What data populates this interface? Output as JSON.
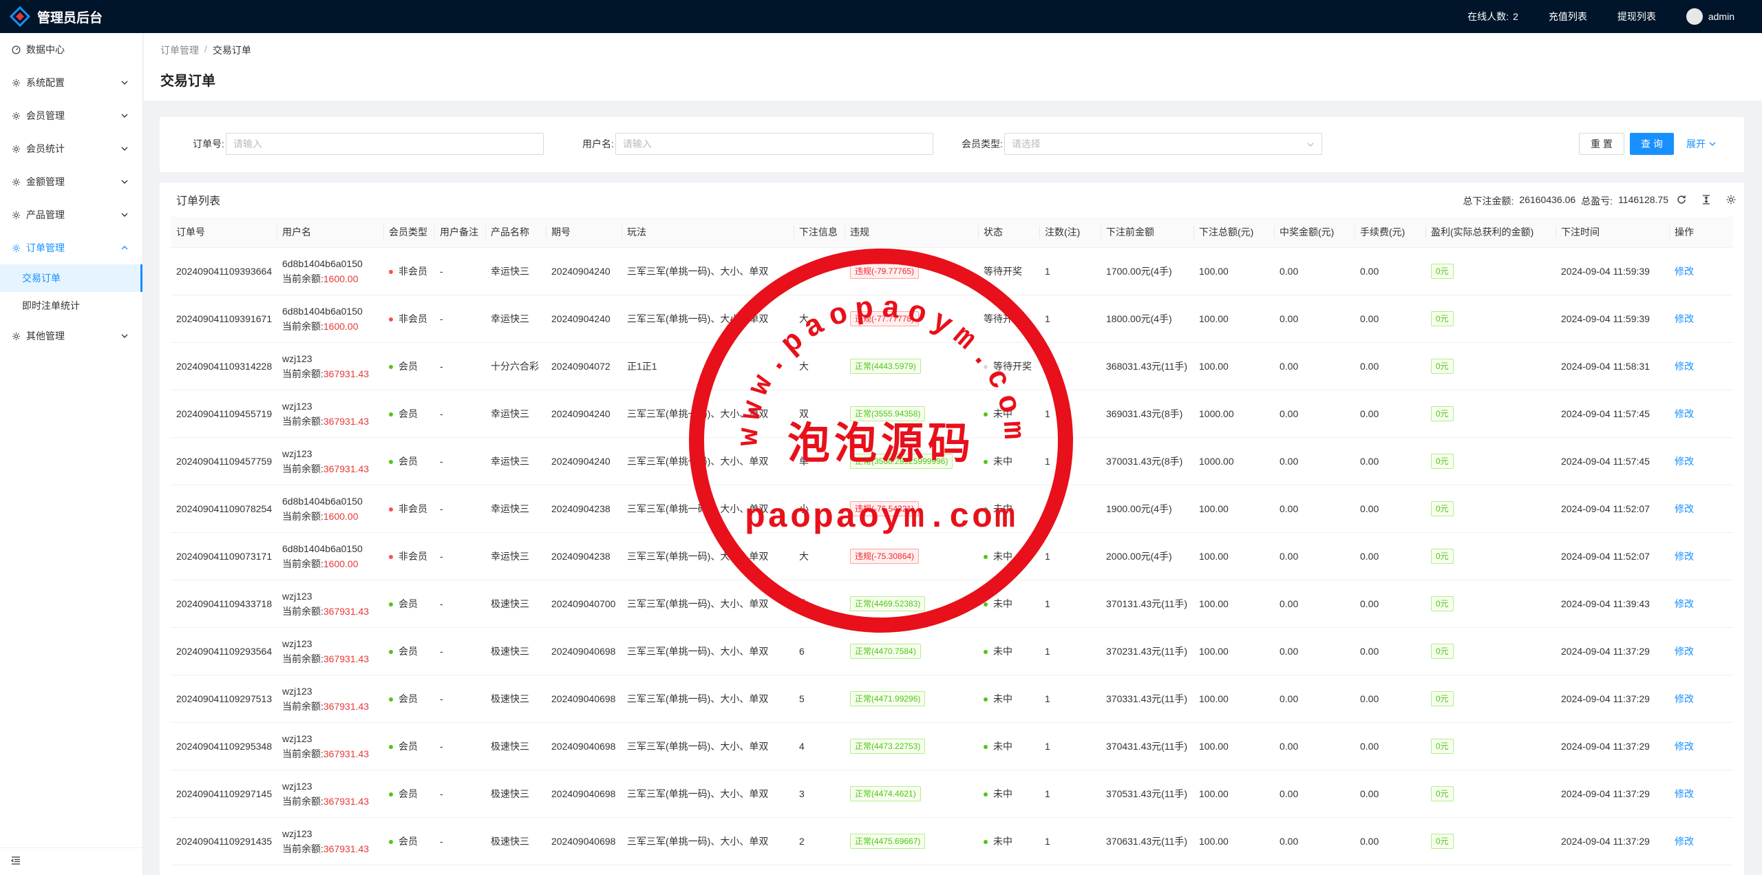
{
  "header": {
    "title": "管理员后台",
    "online_label": "在线人数:",
    "online_count": "2",
    "recharge_list": "充值列表",
    "withdraw_list": "提现列表",
    "user": "admin"
  },
  "sidebar": {
    "items": [
      {
        "label": "数据中心",
        "icon": "dashboard-icon",
        "has_children": false
      },
      {
        "label": "系统配置",
        "icon": "gear-icon",
        "has_children": true
      },
      {
        "label": "会员管理",
        "icon": "gear-icon",
        "has_children": true
      },
      {
        "label": "会员统计",
        "icon": "gear-icon",
        "has_children": true
      },
      {
        "label": "金额管理",
        "icon": "gear-icon",
        "has_children": true
      },
      {
        "label": "产品管理",
        "icon": "gear-icon",
        "has_children": true
      },
      {
        "label": "订单管理",
        "icon": "gear-icon",
        "has_children": true,
        "open": true
      },
      {
        "label": "其他管理",
        "icon": "gear-icon",
        "has_children": true
      }
    ],
    "sub_items": [
      "交易订单",
      "即时注单统计"
    ]
  },
  "breadcrumb": {
    "parent": "订单管理",
    "sep": "/",
    "current": "交易订单"
  },
  "page_title": "交易订单",
  "search": {
    "order_no_label": "订单号:",
    "order_no_placeholder": "请输入",
    "username_label": "用户名:",
    "username_placeholder": "请输入",
    "member_type_label": "会员类型:",
    "member_type_placeholder": "请选择",
    "reset": "重 置",
    "query": "查 询",
    "expand": "展开"
  },
  "table": {
    "title": "订单列表",
    "total_bet_label": "总下注金额:",
    "total_bet": "26160436.06",
    "total_profit_label": "总盈亏:",
    "total_profit": "1146128.75",
    "columns": [
      "订单号",
      "用户名",
      "会员类型",
      "用户备注",
      "产品名称",
      "期号",
      "玩法",
      "下注信息",
      "违规",
      "状态",
      "注数(注)",
      "下注前金额",
      "下注总额(元)",
      "中奖金额(元)",
      "手续费(元)",
      "盈利(实际总获利的金额)",
      "下注时间",
      "操作"
    ],
    "balance_label": "当前余额:",
    "edit_label": "修改",
    "rows": [
      {
        "order": "202409041109393664",
        "user": "6d8b1404b6a0150",
        "balance": "1600.00",
        "member": "非会员",
        "member_color": "red",
        "remark": "-",
        "product": "幸运快三",
        "period": "20240904240",
        "play": "三军三军(单挑一码)、大小、单双",
        "bet": "小",
        "violation": "违规(-79.77765)",
        "violation_type": "red",
        "status": "等待开奖",
        "status_dot": "none",
        "count": "1",
        "before": "1700.00元(4手)",
        "total": "100.00",
        "win": "0.00",
        "fee": "0.00",
        "profit": "0元",
        "time": "2024-09-04 11:59:39"
      },
      {
        "order": "202409041109391671",
        "user": "6d8b1404b6a0150",
        "balance": "1600.00",
        "member": "非会员",
        "member_color": "red",
        "remark": "-",
        "product": "幸运快三",
        "period": "20240904240",
        "play": "三军三军(单挑一码)、大小、单双",
        "bet": "大",
        "violation": "违规(-77.77778)",
        "violation_type": "red",
        "status": "等待开奖",
        "status_dot": "none",
        "count": "1",
        "before": "1800.00元(4手)",
        "total": "100.00",
        "win": "0.00",
        "fee": "0.00",
        "profit": "0元",
        "time": "2024-09-04 11:59:39"
      },
      {
        "order": "202409041109314228",
        "user": "wzj123",
        "balance": "367931.43",
        "member": "会员",
        "member_color": "green",
        "remark": "-",
        "product": "十分六合彩",
        "period": "20240904072",
        "play": "正1正1",
        "bet": "大",
        "violation": "正常(4443.5979)",
        "violation_type": "green",
        "status": "等待开奖",
        "status_dot": "grey",
        "count": "1",
        "before": "368031.43元(11手)",
        "total": "100.00",
        "win": "0.00",
        "fee": "0.00",
        "profit": "0元",
        "time": "2024-09-04 11:58:31"
      },
      {
        "order": "202409041109455719",
        "user": "wzj123",
        "balance": "367931.43",
        "member": "会员",
        "member_color": "green",
        "remark": "-",
        "product": "幸运快三",
        "period": "20240904240",
        "play": "三军三军(单挑一码)、大小、单双",
        "bet": "双",
        "violation": "正常(3555.94358)",
        "violation_type": "green",
        "status": "未中",
        "status_dot": "green",
        "count": "1",
        "before": "369031.43元(8手)",
        "total": "1000.00",
        "win": "0.00",
        "fee": "0.00",
        "profit": "0元",
        "time": "2024-09-04 11:57:45"
      },
      {
        "order": "202409041109457759",
        "user": "wzj123",
        "balance": "367931.43",
        "member": "会员",
        "member_color": "green",
        "remark": "-",
        "product": "幸运快三",
        "period": "20240904240",
        "play": "三军三军(单挑一码)、大小、单双",
        "bet": "单",
        "violation": "正常(3568.28925999996)",
        "violation_type": "green",
        "status": "未中",
        "status_dot": "green",
        "count": "1",
        "before": "370031.43元(8手)",
        "total": "1000.00",
        "win": "0.00",
        "fee": "0.00",
        "profit": "0元",
        "time": "2024-09-04 11:57:45"
      },
      {
        "order": "202409041109078254",
        "user": "6d8b1404b6a0150",
        "balance": "1600.00",
        "member": "非会员",
        "member_color": "red",
        "remark": "-",
        "product": "幸运快三",
        "period": "20240904238",
        "play": "三军三军(单挑一码)、大小、单双",
        "bet": "小",
        "violation": "违规(-76.54321)",
        "violation_type": "red",
        "status": "未中",
        "status_dot": "green",
        "count": "1",
        "before": "1900.00元(4手)",
        "total": "100.00",
        "win": "0.00",
        "fee": "0.00",
        "profit": "0元",
        "time": "2024-09-04 11:52:07"
      },
      {
        "order": "202409041109073171",
        "user": "6d8b1404b6a0150",
        "balance": "1600.00",
        "member": "非会员",
        "member_color": "red",
        "remark": "-",
        "product": "幸运快三",
        "period": "20240904238",
        "play": "三军三军(单挑一码)、大小、单双",
        "bet": "大",
        "violation": "违规(-75.30864)",
        "violation_type": "red",
        "status": "未中",
        "status_dot": "green",
        "count": "1",
        "before": "2000.00元(4手)",
        "total": "100.00",
        "win": "0.00",
        "fee": "0.00",
        "profit": "0元",
        "time": "2024-09-04 11:52:07"
      },
      {
        "order": "202409041109433718",
        "user": "wzj123",
        "balance": "367931.43",
        "member": "会员",
        "member_color": "green",
        "remark": "-",
        "product": "极速快三",
        "period": "202409040700",
        "play": "三军三军(单挑一码)、大小、单双",
        "bet": "大",
        "violation": "正常(4469.52383)",
        "violation_type": "green",
        "status": "未中",
        "status_dot": "green",
        "count": "1",
        "before": "370131.43元(11手)",
        "total": "100.00",
        "win": "0.00",
        "fee": "0.00",
        "profit": "0元",
        "time": "2024-09-04 11:39:43"
      },
      {
        "order": "202409041109293564",
        "user": "wzj123",
        "balance": "367931.43",
        "member": "会员",
        "member_color": "green",
        "remark": "-",
        "product": "极速快三",
        "period": "202409040698",
        "play": "三军三军(单挑一码)、大小、单双",
        "bet": "6",
        "violation": "正常(4470.7584)",
        "violation_type": "green",
        "status": "未中",
        "status_dot": "green",
        "count": "1",
        "before": "370231.43元(11手)",
        "total": "100.00",
        "win": "0.00",
        "fee": "0.00",
        "profit": "0元",
        "time": "2024-09-04 11:37:29"
      },
      {
        "order": "202409041109297513",
        "user": "wzj123",
        "balance": "367931.43",
        "member": "会员",
        "member_color": "green",
        "remark": "-",
        "product": "极速快三",
        "period": "202409040698",
        "play": "三军三军(单挑一码)、大小、单双",
        "bet": "5",
        "violation": "正常(4471.99296)",
        "violation_type": "green",
        "status": "未中",
        "status_dot": "green",
        "count": "1",
        "before": "370331.43元(11手)",
        "total": "100.00",
        "win": "0.00",
        "fee": "0.00",
        "profit": "0元",
        "time": "2024-09-04 11:37:29"
      },
      {
        "order": "202409041109295348",
        "user": "wzj123",
        "balance": "367931.43",
        "member": "会员",
        "member_color": "green",
        "remark": "-",
        "product": "极速快三",
        "period": "202409040698",
        "play": "三军三军(单挑一码)、大小、单双",
        "bet": "4",
        "violation": "正常(4473.22753)",
        "violation_type": "green",
        "status": "未中",
        "status_dot": "green",
        "count": "1",
        "before": "370431.43元(11手)",
        "total": "100.00",
        "win": "0.00",
        "fee": "0.00",
        "profit": "0元",
        "time": "2024-09-04 11:37:29"
      },
      {
        "order": "202409041109297145",
        "user": "wzj123",
        "balance": "367931.43",
        "member": "会员",
        "member_color": "green",
        "remark": "-",
        "product": "极速快三",
        "period": "202409040698",
        "play": "三军三军(单挑一码)、大小、单双",
        "bet": "3",
        "violation": "正常(4474.4621)",
        "violation_type": "green",
        "status": "未中",
        "status_dot": "green",
        "count": "1",
        "before": "370531.43元(11手)",
        "total": "100.00",
        "win": "0.00",
        "fee": "0.00",
        "profit": "0元",
        "time": "2024-09-04 11:37:29"
      },
      {
        "order": "202409041109291435",
        "user": "wzj123",
        "balance": "367931.43",
        "member": "会员",
        "member_color": "green",
        "remark": "-",
        "product": "极速快三",
        "period": "202409040698",
        "play": "三军三军(单挑一码)、大小、单双",
        "bet": "2",
        "violation": "正常(4475.69667)",
        "violation_type": "green",
        "status": "未中",
        "status_dot": "green",
        "count": "1",
        "before": "370631.43元(11手)",
        "total": "100.00",
        "win": "0.00",
        "fee": "0.00",
        "profit": "0元",
        "time": "2024-09-04 11:37:29"
      }
    ]
  },
  "watermark": {
    "top_text": "www.paopaoym.com",
    "center_text": "泡泡源码",
    "bottom_text": "paopaoym.com",
    "color": "#e8101a"
  },
  "colors": {
    "header_bg": "#001529",
    "accent": "#1890ff",
    "danger": "#e53935",
    "success": "#52c41a"
  }
}
